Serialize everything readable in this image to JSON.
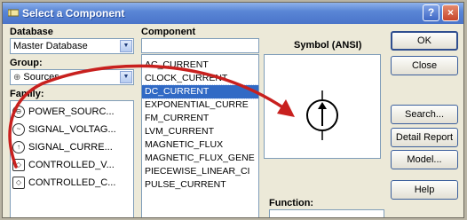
{
  "titlebar": {
    "title": "Select a Component",
    "help_label": "?",
    "close_label": "×"
  },
  "database": {
    "label": "Database",
    "value": "Master Database"
  },
  "group": {
    "label": "Group:",
    "value": "Sources"
  },
  "family": {
    "label": "Family:",
    "items": [
      {
        "label": "POWER_SOURC...",
        "icon": "power-source-icon"
      },
      {
        "label": "SIGNAL_VOLTAG...",
        "icon": "signal-voltage-icon"
      },
      {
        "label": "SIGNAL_CURRE...",
        "icon": "signal-current-icon"
      },
      {
        "label": "CONTROLLED_V...",
        "icon": "controlled-voltage-icon"
      },
      {
        "label": "CONTROLLED_C...",
        "icon": "controlled-current-icon"
      }
    ]
  },
  "component": {
    "label": "Component",
    "items": [
      {
        "label": "AC_CURRENT",
        "selected": false
      },
      {
        "label": "CLOCK_CURRENT",
        "selected": false
      },
      {
        "label": "DC_CURRENT",
        "selected": true
      },
      {
        "label": "EXPONENTIAL_CURRE",
        "selected": false
      },
      {
        "label": "FM_CURRENT",
        "selected": false
      },
      {
        "label": "LVM_CURRENT",
        "selected": false
      },
      {
        "label": "MAGNETIC_FLUX",
        "selected": false
      },
      {
        "label": "MAGNETIC_FLUX_GENE",
        "selected": false
      },
      {
        "label": "PIECEWISE_LINEAR_CI",
        "selected": false
      },
      {
        "label": "PULSE_CURRENT",
        "selected": false
      }
    ]
  },
  "symbol": {
    "label": "Symbol (ANSI)"
  },
  "function": {
    "label": "Function:"
  },
  "buttons": {
    "ok": "OK",
    "close": "Close",
    "search": "Search...",
    "detail_report": "Detail Report",
    "model": "Model...",
    "help": "Help"
  },
  "colors": {
    "selection": "#316ac5",
    "annotation_arrow": "#c8201e"
  }
}
